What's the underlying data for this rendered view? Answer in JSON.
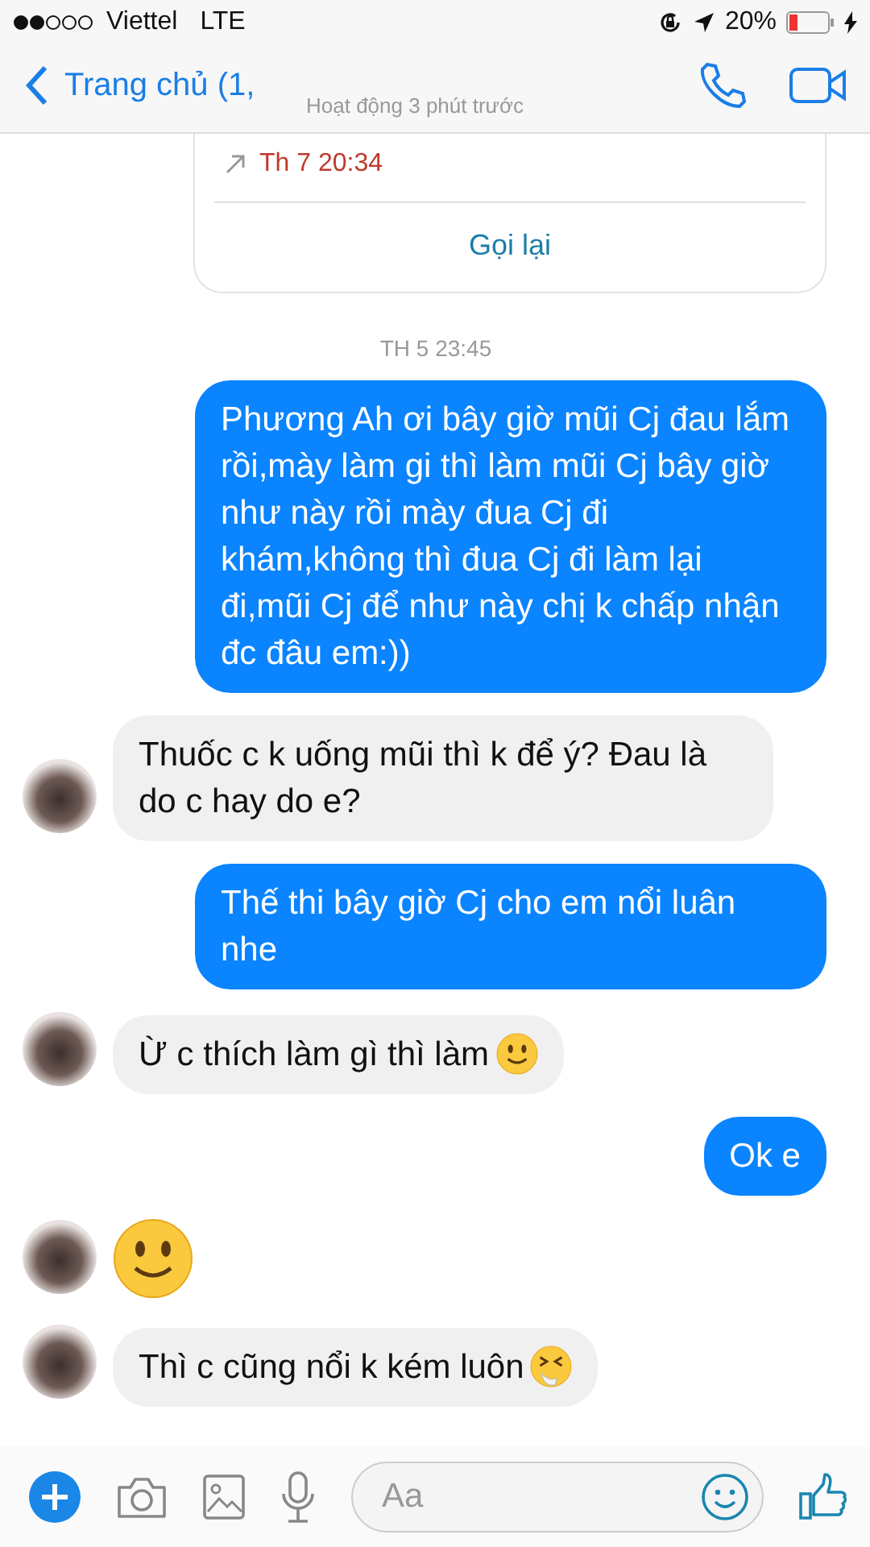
{
  "status_bar": {
    "carrier": "Viettel",
    "network": "LTE",
    "battery": "20%"
  },
  "header": {
    "back_label": "Trang chủ (1,",
    "subtitle": "Hoạt động 3 phút trước"
  },
  "call_card": {
    "time": "Th 7 20:34",
    "action": "Gọi lại"
  },
  "timestamp": "TH 5 23:45",
  "messages": [
    {
      "sent": true,
      "kind": "text",
      "text": "Phương Ah ơi bây giờ mũi Cj đau lắm rồi,mày làm gi thì làm mũi Cj bây giờ như này rồi mày đua Cj đi khám,không thì đua Cj đi làm lại đi,mũi Cj để như này chị k chấp nhận đc đâu em:))"
    },
    {
      "sent": false,
      "kind": "text",
      "text": "Thuốc c k uống mũi thì k để ý? Đau là do c hay do e?",
      "avatar": true
    },
    {
      "sent": true,
      "kind": "text",
      "text": "Thế thi bây giờ Cj cho em nổi luân nhe"
    },
    {
      "sent": false,
      "kind": "text_smile",
      "text": "Ừ c thích làm gì thì làm",
      "avatar": true
    },
    {
      "sent": true,
      "kind": "text",
      "text": "Ok e"
    },
    {
      "sent": false,
      "kind": "big_smile",
      "avatar": true
    },
    {
      "sent": false,
      "kind": "text_sneeze",
      "text": "Thì c cũng nổi k kém luôn",
      "avatar": true
    }
  ],
  "composer": {
    "placeholder": "Aa"
  }
}
